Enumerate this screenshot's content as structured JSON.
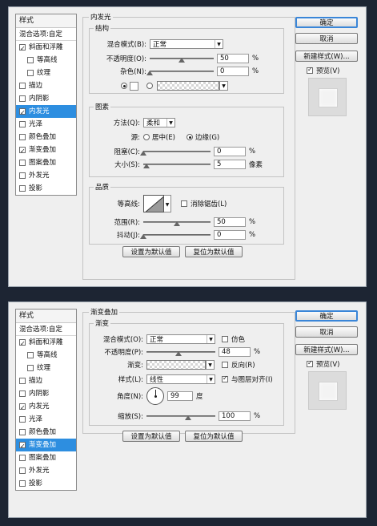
{
  "sidebar": {
    "header": "样式",
    "blend_options": "混合选项:自定",
    "items": [
      {
        "label": "斜面和浮雕",
        "checked": true
      },
      {
        "label": "等高线",
        "checked": false
      },
      {
        "label": "纹理",
        "checked": false
      },
      {
        "label": "描边",
        "checked": false
      },
      {
        "label": "内阴影",
        "checked": false
      },
      {
        "label": "内发光",
        "checked": true
      },
      {
        "label": "光泽",
        "checked": false
      },
      {
        "label": "颜色叠加",
        "checked": false
      },
      {
        "label": "渐变叠加",
        "checked": true
      },
      {
        "label": "图案叠加",
        "checked": false
      },
      {
        "label": "外发光",
        "checked": false
      },
      {
        "label": "投影",
        "checked": false
      }
    ]
  },
  "buttons": {
    "ok": "确定",
    "cancel": "取消",
    "new_style": "新建样式(W)...",
    "preview": "预览(V)",
    "set_default": "设置为默认值",
    "reset_default": "复位为默认值"
  },
  "inner_glow": {
    "title": "内发光",
    "structure": "结构",
    "blend_mode_label": "混合模式(B):",
    "blend_mode": "正常",
    "opacity_label": "不透明度(O):",
    "opacity": "50",
    "noise_label": "杂色(N):",
    "noise": "0",
    "elements": "图素",
    "method_label": "方法(Q):",
    "method": "柔和",
    "source_label": "源:",
    "source_center": "居中(E)",
    "source_edge": "边缘(G)",
    "choke_label": "阻塞(C):",
    "choke": "0",
    "size_label": "大小(S):",
    "size": "5",
    "size_unit": "像素",
    "quality": "品质",
    "contour_label": "等高线:",
    "antialias": "消除锯齿(L)",
    "range_label": "范围(R):",
    "range": "50",
    "jitter_label": "抖动(J):",
    "jitter": "0",
    "percent": "%"
  },
  "gradient_overlay": {
    "title": "渐变叠加",
    "section": "渐变",
    "blend_mode_label": "混合模式(O):",
    "blend_mode": "正常",
    "dither": "仿色",
    "opacity_label": "不透明度(P):",
    "opacity": "48",
    "gradient_label": "渐变:",
    "reverse": "反向(R)",
    "style_label": "样式(L):",
    "style": "线性",
    "align": "与图层对齐(I)",
    "angle_label": "角度(N):",
    "angle": "99",
    "angle_unit": "度",
    "scale_label": "缩放(S):",
    "scale": "100",
    "percent": "%"
  },
  "icons": {
    "check": "checkmark-icon",
    "dropdown": "chevron-down-icon",
    "radio": "radio-icon"
  }
}
